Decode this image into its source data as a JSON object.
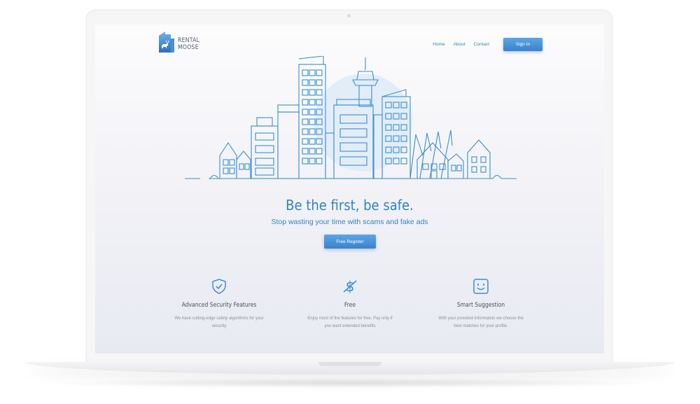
{
  "brand": {
    "line1": "RENTAL",
    "line2": "MOOSE"
  },
  "nav": {
    "home": "Home",
    "about": "About",
    "contact": "Contact",
    "signin": "Sign In"
  },
  "hero": {
    "headline": "Be the first, be safe.",
    "subline": "Stop wasting your time with scams and fake ads",
    "cta": "Free Register"
  },
  "features": [
    {
      "icon": "shield-check-icon",
      "title": "Advanced Security Features",
      "desc": "We have cutting-edge safety algorithms for your security"
    },
    {
      "icon": "dollar-crossed-icon",
      "title": "Free",
      "desc": "Enjoy most of the features for free. Pay only if you want extended benefits"
    },
    {
      "icon": "smiley-face-icon",
      "title": "Smart Suggestion",
      "desc": "With your provided information we choose the best matches for your profile."
    }
  ],
  "colors": {
    "accent": "#2f86c0",
    "button": "#4a94d8",
    "outline": "#3a8fcf"
  }
}
